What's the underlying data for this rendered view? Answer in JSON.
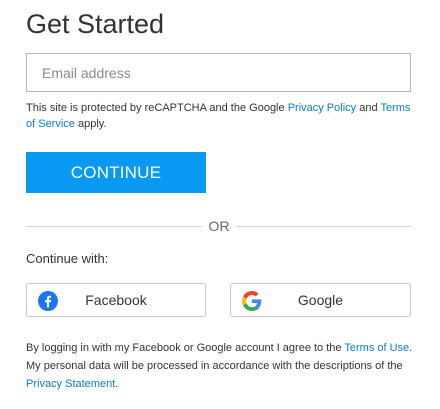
{
  "header": {
    "title": "Get Started"
  },
  "email": {
    "placeholder": "Email address",
    "value": ""
  },
  "recaptcha": {
    "prefix": "This site is protected by reCAPTCHA and the Google ",
    "privacy_link": "Privacy Policy",
    "middle": " and ",
    "terms_link": "Terms of Service",
    "suffix": " apply."
  },
  "continue_button": {
    "label": "CONTINUE"
  },
  "divider": {
    "label": "OR"
  },
  "social": {
    "heading": "Continue with:",
    "facebook_label": "Facebook",
    "google_label": "Google",
    "facebook_icon": "facebook-icon",
    "google_icon": "google-icon"
  },
  "consent": {
    "prefix": "By logging in with my Facebook or Google account I agree to the ",
    "terms_link": "Terms of Use",
    "middle": ". My personal data will be processed in accordance with the descriptions of the ",
    "privacy_link": "Privacy Statement",
    "suffix": "."
  },
  "colors": {
    "accent": "#0a99f2",
    "link": "#0a7ec2",
    "facebook": "#1877f2"
  }
}
